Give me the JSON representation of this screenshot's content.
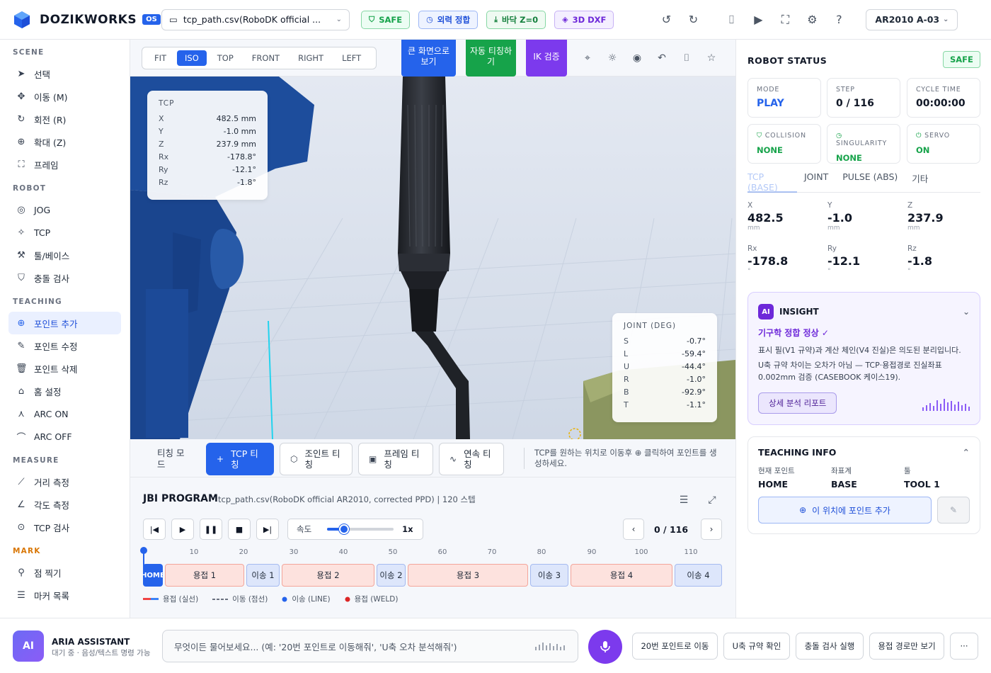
{
  "header": {
    "brand": "DOZIKWORKS",
    "badge": "OS",
    "file": "tcp_path.csv(RoboDK official ...",
    "chips": {
      "safe": "SAFE",
      "fit": "외력 정합",
      "floor": "바닥 Z=0",
      "dxf": "3D DXF"
    },
    "robot": "AR2010 A-03",
    "icons": [
      "undo-icon",
      "redo-icon",
      "camera-icon",
      "video-icon",
      "fullscreen-icon",
      "gear-icon",
      "help-icon"
    ]
  },
  "sidebar": {
    "scene_label": "SCENE",
    "scene": [
      "선택",
      "이동 (M)",
      "회전 (R)",
      "확대 (Z)",
      "프레임"
    ],
    "robot_label": "ROBOT",
    "robot": [
      "JOG",
      "TCP",
      "툴/베이스",
      "충돌 검사"
    ],
    "teaching_label": "TEACHING",
    "teaching": [
      "포인트 추가",
      "포인트 수정",
      "포인트 삭제",
      "홈 설정",
      "ARC ON",
      "ARC OFF"
    ],
    "measure_label": "MEASURE",
    "measure": [
      "거리 측정",
      "각도 측정",
      "TCP 검사"
    ],
    "mark_label": "MARK",
    "mark": [
      "점 찍기",
      "마커 목록"
    ]
  },
  "viewport": {
    "views": [
      "FIT",
      "ISO",
      "TOP",
      "FRONT",
      "RIGHT",
      "LEFT"
    ],
    "active_view": "ISO",
    "big_view": "큰 화면으로 보기",
    "auto_teach": "자동 티칭하기",
    "ik": "IK 검증",
    "tcp": {
      "title": "TCP",
      "rows": [
        {
          "k": "X",
          "v": "482.5 mm"
        },
        {
          "k": "Y",
          "v": "-1.0 mm"
        },
        {
          "k": "Z",
          "v": "237.9 mm"
        },
        {
          "k": "Rx",
          "v": "-178.8°"
        },
        {
          "k": "Ry",
          "v": "-12.1°"
        },
        {
          "k": "Rz",
          "v": "-1.8°"
        }
      ]
    },
    "joint": {
      "title": "JOINT (DEG)",
      "rows": [
        {
          "k": "S",
          "v": "-0.7°"
        },
        {
          "k": "L",
          "v": "-59.4°"
        },
        {
          "k": "U",
          "v": "-44.4°"
        },
        {
          "k": "R",
          "v": "-1.0°"
        },
        {
          "k": "B",
          "v": "-92.9°"
        },
        {
          "k": "T",
          "v": "-1.1°"
        }
      ]
    }
  },
  "teach_mode": {
    "label": "티칭 모드",
    "buttons": [
      "TCP 티칭",
      "조인트 티칭",
      "프레임 티칭",
      "연속 티칭"
    ],
    "hint": "TCP를 원하는 위치로 이동후 ⊕ 클릭하여 포인트를 생성하세요."
  },
  "jbi": {
    "title": "JBI PROGRAM",
    "subtitle": "tcp_path.csv(RoboDK official AR2010, corrected PPD) | 120 스텝",
    "speed_label": "속도",
    "speed_value": "1x",
    "speed_fraction": 0.25,
    "position": "0 / 116",
    "ticks": [
      "10",
      "20",
      "30",
      "40",
      "50",
      "60",
      "70",
      "80",
      "90",
      "100",
      "110"
    ],
    "segments": [
      {
        "label": "HOME",
        "type": "home"
      },
      {
        "label": "용접 1",
        "type": "weld"
      },
      {
        "label": "이송 1",
        "type": "move"
      },
      {
        "label": "용접 2",
        "type": "weld"
      },
      {
        "label": "이송 2",
        "type": "move"
      },
      {
        "label": "용접 3",
        "type": "weld"
      },
      {
        "label": "이송 3",
        "type": "move"
      },
      {
        "label": "용접 4",
        "type": "weld"
      },
      {
        "label": "이송 4",
        "type": "move"
      }
    ],
    "legend": [
      "용접 (실선)",
      "이동 (점선)",
      "이송 (LINE)",
      "용접 (WELD)"
    ]
  },
  "status": {
    "title": "ROBOT STATUS",
    "safe": "SAFE",
    "cards": [
      {
        "label": "MODE",
        "value": "PLAY"
      },
      {
        "label": "STEP",
        "value": "0 / 116"
      },
      {
        "label": "CYCLE TIME",
        "value": "00:00:00"
      },
      {
        "label": "COLLISION",
        "value": "NONE"
      },
      {
        "label": "SINGULARITY",
        "value": "NONE"
      },
      {
        "label": "SERVO",
        "value": "ON"
      }
    ],
    "tabs": [
      "TCP (BASE)",
      "JOINT",
      "PULSE (ABS)",
      "기타"
    ],
    "coords": [
      {
        "label": "X",
        "value": "482.5",
        "unit": "mm"
      },
      {
        "label": "Y",
        "value": "-1.0",
        "unit": "mm"
      },
      {
        "label": "Z",
        "value": "237.9",
        "unit": "mm"
      },
      {
        "label": "Rx",
        "value": "-178.8",
        "unit": "°"
      },
      {
        "label": "Ry",
        "value": "-12.1",
        "unit": "°"
      },
      {
        "label": "Rz",
        "value": "-1.8",
        "unit": "°"
      }
    ]
  },
  "insight": {
    "badge": "AI",
    "title": "INSIGHT",
    "headline": "기구학 정합 정상 ✓",
    "p1": "표시 필(V1 규약)과 계산 체인(V4 진실)은 의도된 분리입니다.",
    "p2": "U축 규약 차이는 오차가 아님 — TCP·용접경로 진실좌표 0.002mm 검증 (CASEBOOK 케이스19).",
    "button": "상세 분석 리포트"
  },
  "teaching_info": {
    "title": "TEACHING INFO",
    "cols": [
      {
        "label": "현재 포인트",
        "value": "HOME"
      },
      {
        "label": "좌표계",
        "value": "BASE"
      },
      {
        "label": "툴",
        "value": "TOOL 1"
      }
    ],
    "add": "이 위치에 포인트 추가"
  },
  "assistant": {
    "badge": "AI",
    "name": "ARIA ASSISTANT",
    "status": "대기 중 · 음성/텍스트 명령 가능",
    "placeholder": "무엇이든 물어보세요... (예: '20번 포인트로 이동해줘', 'U축 오차 분석해줘')",
    "quick": [
      "20번 포인트로 이동",
      "U축 규약 확인",
      "충돌 검사 실행",
      "용접 경로만 보기"
    ]
  },
  "colors": {
    "accent": "#2563eb",
    "safe": "#16a34a",
    "ai": "#7c3aed",
    "weld": "#fde2de",
    "move": "#dde6fb"
  }
}
